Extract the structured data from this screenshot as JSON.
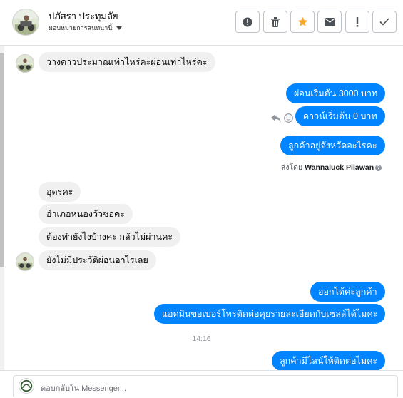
{
  "header": {
    "name": "ปภัสรา ประทุมลัย",
    "assign_label": "มอบหมายการสนทนานี้",
    "toolbar": [
      {
        "name": "spam-report-button",
        "icon": "alert-circle-icon"
      },
      {
        "name": "delete-button",
        "icon": "trash-icon"
      },
      {
        "name": "star-button",
        "icon": "star-icon"
      },
      {
        "name": "mark-unread-button",
        "icon": "envelope-icon"
      },
      {
        "name": "follow-up-button",
        "icon": "exclamation-icon"
      },
      {
        "name": "mark-done-button",
        "icon": "check-icon"
      }
    ]
  },
  "messages": {
    "m1": "วางดาวประมาณเท่าไหร่คะผ่อนเท่าไหร่คะ",
    "m2": "ผ่อนเริ่มต้น 3000  บาท",
    "m3": "ดาวน์เริ่มต้น 0 บาท",
    "m4": "ลูกค้าอยู่จังหวัดอะไรคะ",
    "sent_by_prefix": "ส่งโดย",
    "sent_by_name": "Wannaluck Pilawan",
    "m5": "อุดรคะ",
    "m6": "อำเภอหนองวัวซอคะ",
    "m7": "ต้องทำยังไงบ้างคะ กลัวไม่ผ่านคะ",
    "m8": "ยังไม่มีประวัติผ่อนอาไรเลย",
    "m9": "ออกได้ค่ะลูกค้า",
    "m10": "แอดมินขอเบอร์โทรติดต่อคุยรายละเอียดกับเซลล์ได้ไมคะ",
    "timestamp": "14:16",
    "m11": "ลูกค้ามีไลน์ให้ติดต่อไมคะ"
  },
  "composer": {
    "placeholder": "ตอบกลับใน Messenger..."
  },
  "colors": {
    "accent_blue": "#0084ff",
    "incoming_bg": "#f1f0f0",
    "star_orange": "#f5a623"
  }
}
